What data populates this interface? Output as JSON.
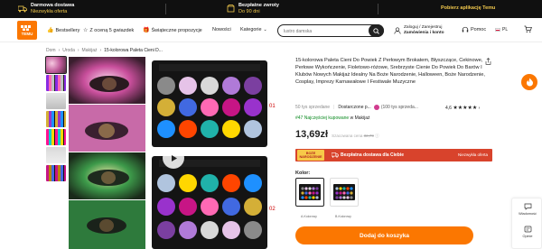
{
  "promo": {
    "item1_title": "Darmowa dostawa",
    "item1_sub": "Niezwykła oferta",
    "item2_title": "Bezpłatne zwroty",
    "item2_sub": "Do 90 dni",
    "item3": "Pobierz aplikację Temu"
  },
  "nav": {
    "logo": "TEMU",
    "bestsellery": "Bestsellery",
    "piec_gwiazdek": "Z oceną 5 gwiazdek",
    "swiateczne": "Świąteczne propozycje",
    "nowosci": "Nowości",
    "kategorie": "Kategorie",
    "search_placeholder": "lustro damska",
    "account_line1": "Zaloguj / Zarejestruj",
    "account_line2": "Zamówienia i konto",
    "pomoc": "Pomoc",
    "lang": "PL"
  },
  "breadcrumb": [
    "Dom",
    "Uroda",
    "Makijaż",
    "15-kolorowa Paleta Cieni D..."
  ],
  "product": {
    "title": "15-kolorowa Paleta Cieni Do Powiek Z Perłowym Brokatem, Błyszczące, Cekinowe, Perłowe Wykończenie, Fioletowo-różowe, Srebrzyste Cienie Do Powiek Do Barów I Klubów Nowych Makijaż Idealny Na Boże Narodzenie, Halloween, Boże Narodzenie, Cosplay, Imprezy Karnawałowe I Festiwale Muzyczne",
    "sold": "50 tys sprzedane",
    "store_prefix": "Dostarczone p...",
    "store_reviews": "(100 tys sprzeda...",
    "rating": "4,6",
    "stars": "★★★★★",
    "rank_prefix": "#47 Najczęściej kupowane",
    "rank_suffix": "w Makijaż",
    "price": "13,69zł",
    "old_price_label": "Szacowana cena",
    "old_price": "32,79",
    "shipping_badge": "BOŻE NARODZENIE",
    "shipping_text": "Bezpłatna dostawa dla Ciebie",
    "shipping_right": "Niezwykła oferta",
    "color_label": "Kolor:",
    "swatch1_caption": "A-Kolorowy",
    "swatch2_caption": "B-Kolorowy",
    "add_to_cart": "Dodaj do koszyka"
  },
  "palette_labels": [
    "01",
    "02"
  ],
  "side": {
    "wiadomosc": "Wiadomość",
    "opinie": "Opinie"
  },
  "colors": {
    "accent": "#fb7701",
    "shipping_bar": "#d8432c",
    "promo_yellow": "#f2c94c"
  }
}
